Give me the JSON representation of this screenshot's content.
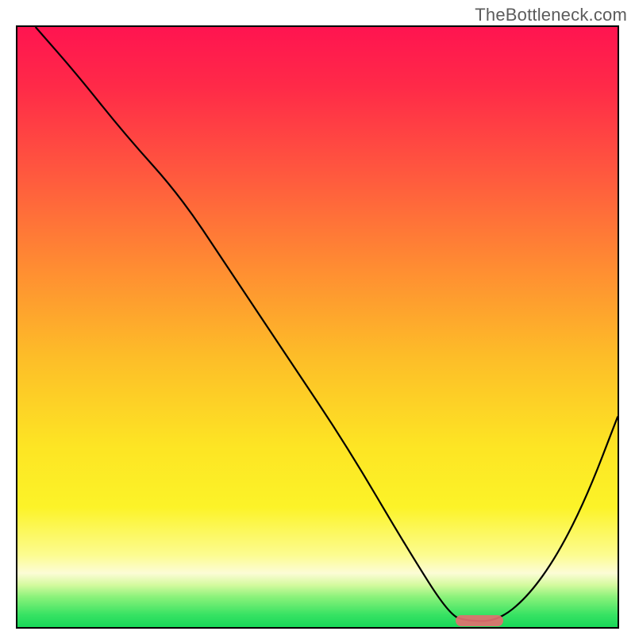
{
  "watermark": "TheBottleneck.com",
  "chart_data": {
    "type": "line",
    "title": "",
    "xlabel": "",
    "ylabel": "",
    "xlim": [
      0,
      100
    ],
    "ylim": [
      0,
      100
    ],
    "grid": false,
    "legend": false,
    "background_gradient": {
      "direction": "vertical-top-to-bottom",
      "stops": [
        {
          "pos": 0,
          "color": "#ff1450"
        },
        {
          "pos": 10,
          "color": "#ff2a48"
        },
        {
          "pos": 25,
          "color": "#ff5a3e"
        },
        {
          "pos": 40,
          "color": "#ff8c32"
        },
        {
          "pos": 55,
          "color": "#fdbd28"
        },
        {
          "pos": 70,
          "color": "#fde524"
        },
        {
          "pos": 80,
          "color": "#fcf328"
        },
        {
          "pos": 88,
          "color": "#fcfc90"
        },
        {
          "pos": 91,
          "color": "#fcfcd6"
        },
        {
          "pos": 93,
          "color": "#d4fa9e"
        },
        {
          "pos": 95,
          "color": "#8af27a"
        },
        {
          "pos": 98,
          "color": "#36e263"
        },
        {
          "pos": 100,
          "color": "#18d858"
        }
      ]
    },
    "series": [
      {
        "name": "bottleneck-curve",
        "color": "#000000",
        "x": [
          3,
          10,
          18,
          27,
          35,
          45,
          55,
          65,
          72,
          75,
          80,
          85,
          90,
          95,
          100
        ],
        "y": [
          100,
          92,
          82,
          72,
          60,
          45,
          30,
          13,
          2,
          1,
          1,
          5,
          12,
          22,
          35
        ]
      }
    ],
    "marker": {
      "name": "ideal-zone-pill",
      "x": 77,
      "y": 1,
      "width_pct": 8,
      "color": "#e27070"
    }
  }
}
